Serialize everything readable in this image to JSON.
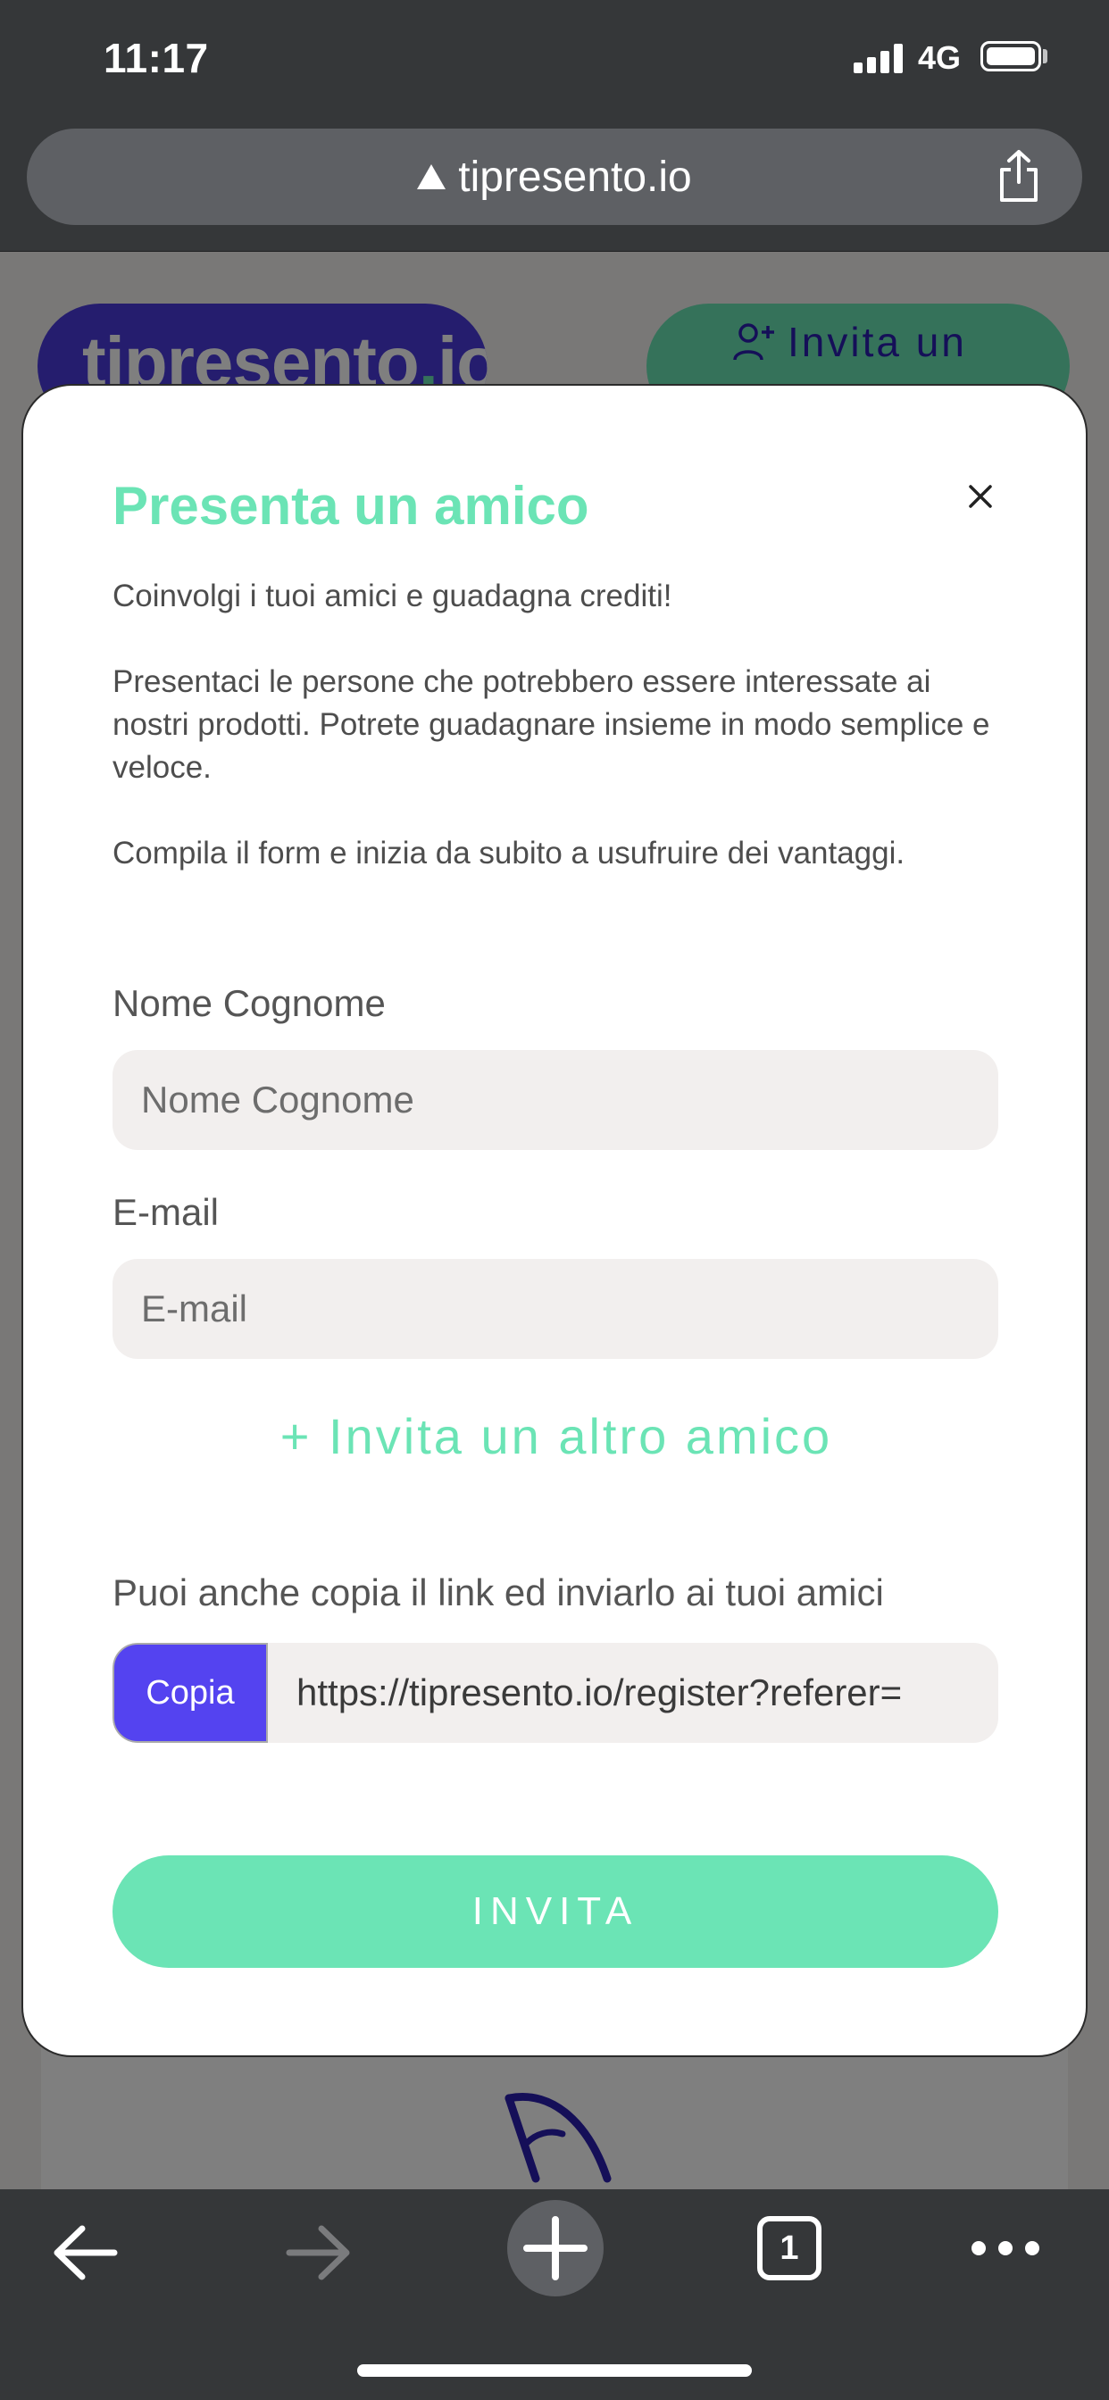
{
  "status_bar": {
    "time": "11:17",
    "network": "4G"
  },
  "browser": {
    "url": "tipresento.io",
    "tab_count": "1",
    "icons": [
      "warning-icon",
      "share-icon",
      "back-arrow-icon",
      "forward-arrow-icon",
      "new-tab-icon",
      "tabs-icon",
      "more-icon"
    ]
  },
  "page": {
    "logo": {
      "text_main": "tipresento",
      "text_dot": ".",
      "text_end": "io"
    },
    "header_invite_label": "Invita un"
  },
  "modal": {
    "title": "Presenta un amico",
    "intro": "Coinvolgi i tuoi amici e guadagna crediti!",
    "description": "Presentaci le persone che potrebbero essere interessate ai nostri prodotti. Potrete guadagnare insieme in modo semplice e veloce.",
    "cta_text": "Compila il form e inizia da subito a usufruire dei vantaggi.",
    "name_label": "Nome Cognome",
    "name_placeholder": "Nome Cognome",
    "email_label": "E-mail",
    "email_placeholder": "E-mail",
    "add_friend": "+ Invita un altro amico",
    "copy_hint": "Puoi anche copia il link ed inviarlo ai tuoi amici",
    "copy_button": "Copia",
    "referral_link": "https://tipresento.io/register?referer=",
    "invite_button": "INVITA"
  },
  "colors": {
    "accent_green": "#6be4b5",
    "brand_purple": "#5443f0",
    "browser_chrome": "#353739"
  }
}
